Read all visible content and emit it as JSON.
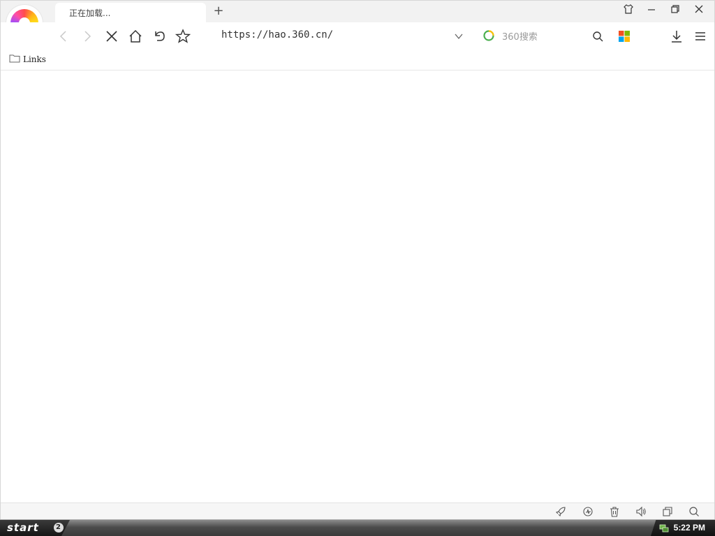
{
  "browser": {
    "tab_title": "正在加载...",
    "new_tab_symbol": "+",
    "address_url": "https://hao.360.cn/",
    "search_placeholder": "360搜索",
    "status": "loading"
  },
  "bookmarks": {
    "items": [
      {
        "label": "Links",
        "icon": "folder-icon"
      }
    ]
  },
  "window_controls": {
    "icons": [
      "skin-icon",
      "minimize-icon",
      "restore-icon",
      "close-icon"
    ]
  },
  "navbar_icons": [
    "back-icon",
    "forward-icon",
    "stop-icon",
    "home-icon",
    "undo-icon",
    "favorite-star-icon",
    "dropdown-chevron-icon",
    "360-search-logo-icon",
    "search-icon",
    "apps-grid-icon",
    "download-icon",
    "menu-icon"
  ],
  "statusbar_icons": [
    "accelerate-rocket-icon",
    "browser-doctor-icon",
    "trash-icon",
    "volume-icon",
    "window-icon",
    "zoom-icon"
  ],
  "taskbar": {
    "start_label": "start",
    "start_orb_symbol": "2",
    "clock": "5:22 PM"
  },
  "colors": {
    "apps_grid": [
      "#f25022",
      "#7fba00",
      "#00a4ef",
      "#ffb900"
    ],
    "search_logo": [
      "#4caf50",
      "#ffc107"
    ]
  }
}
